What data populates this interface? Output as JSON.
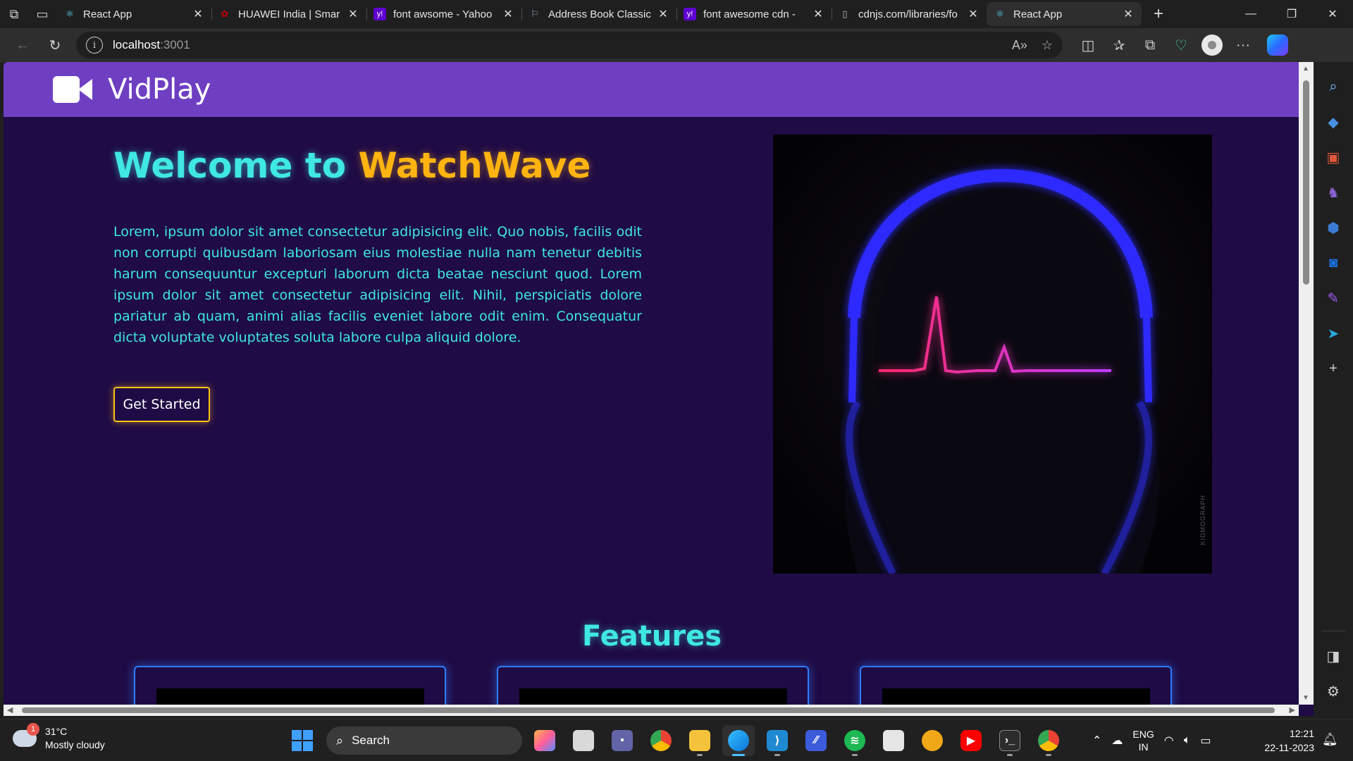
{
  "browser": {
    "tabs": [
      {
        "title": "React App",
        "favicon": "react-icon",
        "active": false
      },
      {
        "title": "HUAWEI India | Smar",
        "favicon": "huawei-icon",
        "active": false
      },
      {
        "title": "font awsome - Yahoo",
        "favicon": "yahoo-icon",
        "active": false
      },
      {
        "title": "Address Book Classic",
        "favicon": "flag-icon",
        "active": false
      },
      {
        "title": "font awesome cdn - ",
        "favicon": "yahoo-icon",
        "active": false
      },
      {
        "title": "cdnjs.com/libraries/fo",
        "favicon": "page-icon",
        "active": false
      },
      {
        "title": "React App",
        "favicon": "react-icon",
        "active": true
      }
    ],
    "address": {
      "host": "localhost",
      "rest": ":3001"
    }
  },
  "page": {
    "brand": "VidPlay",
    "hero": {
      "title_part1": "Welcome to ",
      "title_part2": "WatchWave",
      "body": "Lorem, ipsum dolor sit amet consectetur adipisicing elit. Quo nobis, facilis odit non corrupti quibusdam laboriosam eius molestiae nulla nam tenetur debitis harum consequuntur excepturi laborum dicta beatae nesciunt quod. Lorem ipsum dolor sit amet consectetur adipisicing elit. Nihil, perspiciatis dolore pariatur ab quam, animi alias facilis eveniet labore odit enim. Consequatur dicta voluptate voluptates soluta labore culpa aliquid dolore.",
      "cta_label": "Get Started",
      "art_watermark": "KIDMOGRAPH"
    },
    "features_title": "Features",
    "colors": {
      "navbar": "#6f3fc2",
      "background": "#1f0b45",
      "cyan": "#3fe8e0",
      "gold": "#ffb411",
      "card_border": "#2f7cff"
    }
  },
  "taskbar": {
    "weather": {
      "temp": "31°C",
      "condition": "Mostly cloudy",
      "badge": "1"
    },
    "search_label": "Search",
    "lang_line1": "ENG",
    "lang_line2": "IN",
    "time": "12:21",
    "date": "22-11-2023"
  }
}
